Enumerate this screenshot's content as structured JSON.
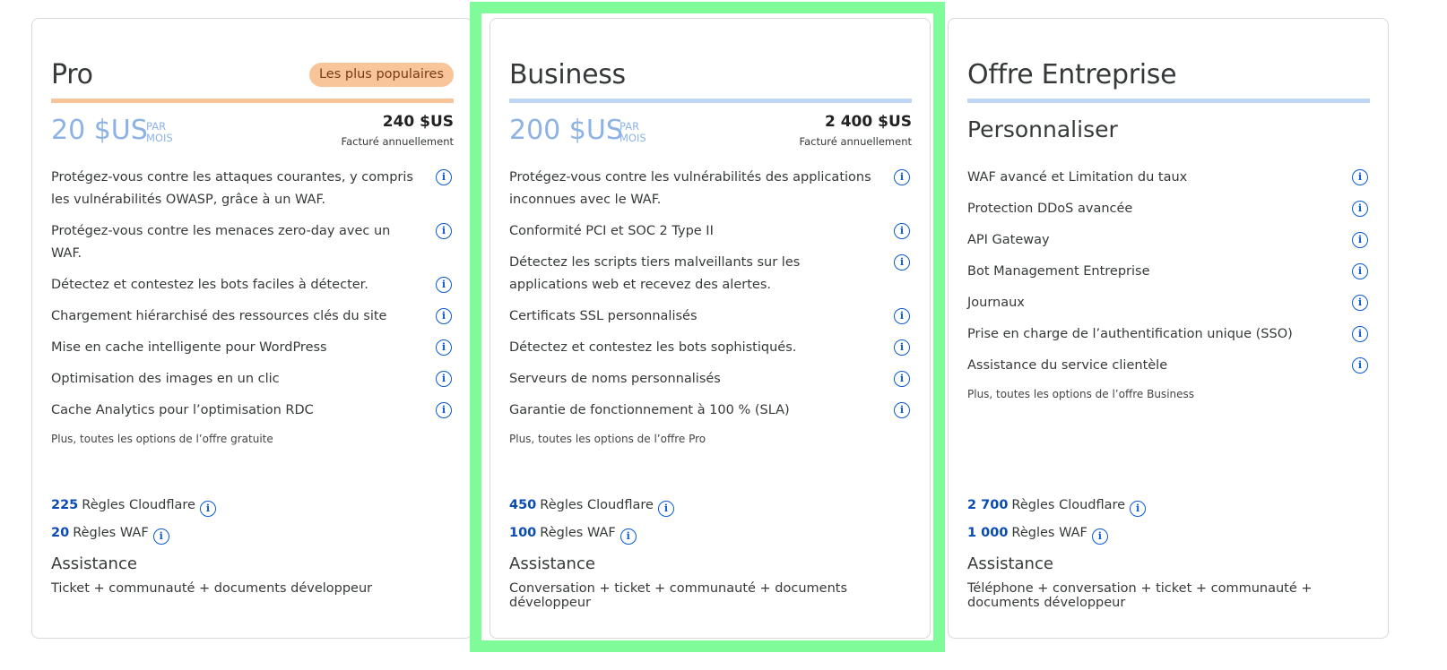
{
  "plans": [
    {
      "name": "Pro",
      "badge": "Les plus populaires",
      "price": "20 $US",
      "per_line1": "PAR",
      "per_line2": "MOIS",
      "annual_amount": "240 $US",
      "annual_note": "Facturé annuellement",
      "features": [
        "Protégez-vous contre les attaques courantes, y compris les vulnérabilités OWASP, grâce à un WAF.",
        "Protégez-vous contre les menaces zero-day avec un WAF.",
        "Détectez et contestez les bots faciles à détecter.",
        "Chargement hiérarchisé des ressources clés du site",
        "Mise en cache intelligente pour WordPress",
        "Optimisation des images en un clic",
        "Cache Analytics pour l’optimisation RDC"
      ],
      "plus_note": "Plus, toutes les options de l’offre gratuite",
      "rules": [
        {
          "count": "225",
          "label": "Règles Cloudflare"
        },
        {
          "count": "20",
          "label": "Règles WAF"
        }
      ],
      "assistance_title": "Assistance",
      "assistance_text": "Ticket + communauté + documents développeur"
    },
    {
      "name": "Business",
      "price": "200 $US",
      "per_line1": "PAR",
      "per_line2": "MOIS",
      "annual_amount": "2 400 $US",
      "annual_note": "Facturé annuellement",
      "features": [
        "Protégez-vous contre les vulnérabilités des applications inconnues avec le WAF.",
        "Conformité PCI et SOC 2 Type II",
        "Détectez les scripts tiers malveillants sur les applications web et recevez des alertes.",
        "Certificats SSL personnalisés",
        "Détectez et contestez les bots sophistiqués.",
        "Serveurs de noms personnalisés",
        "Garantie de fonctionnement à 100 % (SLA)"
      ],
      "plus_note": "Plus, toutes les options de l’offre Pro",
      "rules": [
        {
          "count": "450",
          "label": "Règles Cloudflare"
        },
        {
          "count": "100",
          "label": "Règles WAF"
        }
      ],
      "assistance_title": "Assistance",
      "assistance_text": "Conversation + ticket + communauté + documents développeur"
    },
    {
      "name": "Offre Entreprise",
      "custom_price": "Personnaliser",
      "features": [
        "WAF avancé et Limitation du taux",
        "Protection DDoS avancée",
        "API Gateway",
        "Bot Management Entreprise",
        "Journaux",
        "Prise en charge de l’authentification unique (SSO)",
        "Assistance du service clientèle"
      ],
      "plus_note": "Plus, toutes les options de l’offre Business",
      "rules": [
        {
          "count": "2 700",
          "label": "Règles Cloudflare"
        },
        {
          "count": "1 000",
          "label": "Règles WAF"
        }
      ],
      "assistance_title": "Assistance",
      "assistance_text": "Téléphone + conversation + ticket + communauté + documents développeur"
    }
  ],
  "colors": {
    "highlight": "#80fb9a",
    "badge_bg": "#f8c59a",
    "pro_rule": "#f8c59a",
    "blue_rule": "#bfd6f4",
    "price": "#8db3e6",
    "rule_number": "#0a4bb5",
    "info_icon": "#0a5ad4"
  },
  "icons": {
    "info": "info-icon",
    "info_glyph": "i"
  }
}
